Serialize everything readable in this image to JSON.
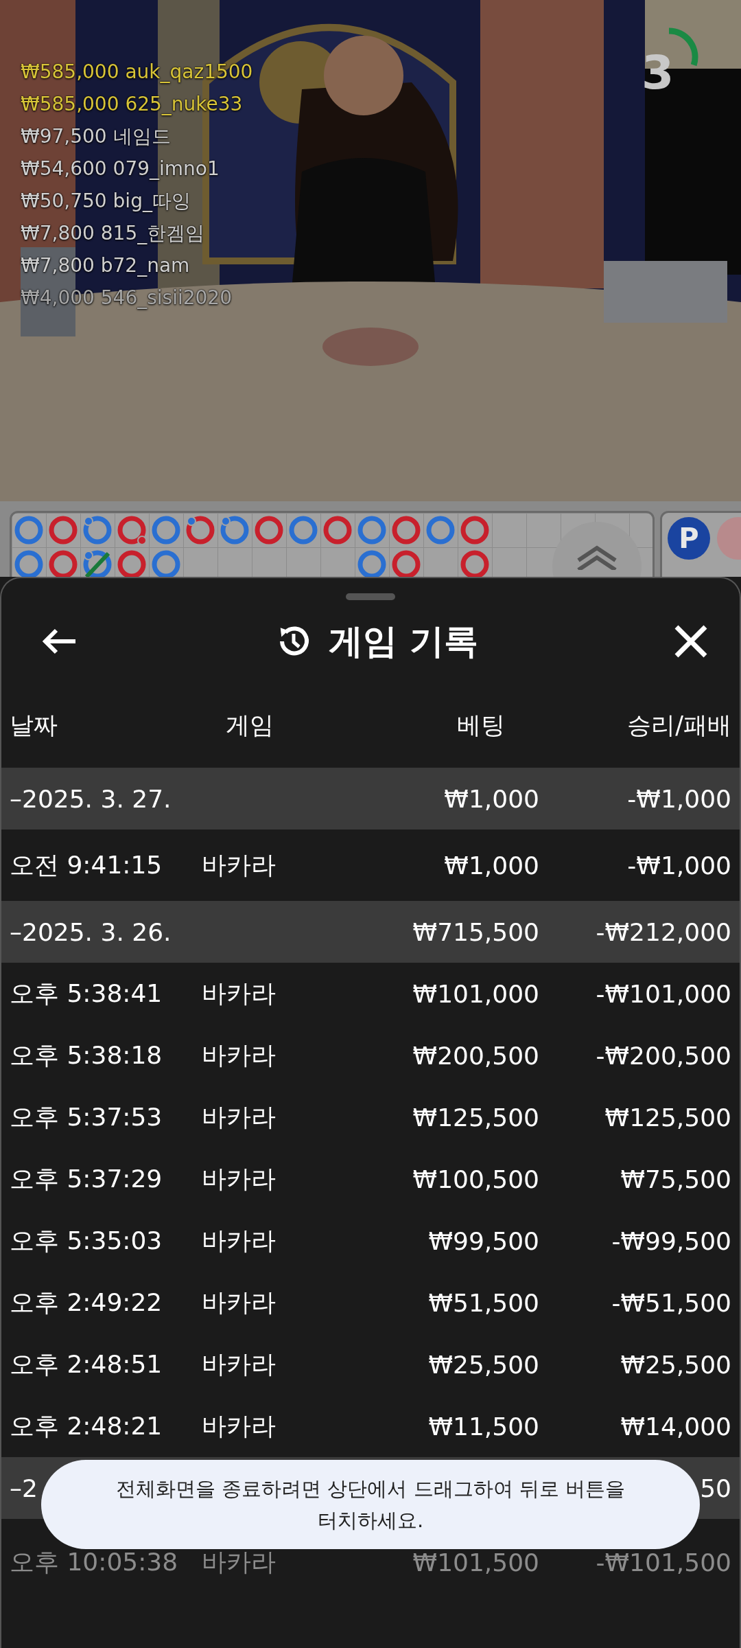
{
  "video": {
    "countdown": {
      "text": "3"
    },
    "bets": [
      {
        "amount": "₩585,000",
        "user": "auk_qaz1500",
        "kind": "top"
      },
      {
        "amount": "₩585,000",
        "user": "625_nuke33",
        "kind": "top"
      },
      {
        "amount": "₩97,500",
        "user": "네임드",
        "kind": "normal"
      },
      {
        "amount": "₩54,600",
        "user": "079_imno1",
        "kind": "normal"
      },
      {
        "amount": "₩50,750",
        "user": "big_따잉",
        "kind": "normal"
      },
      {
        "amount": "₩7,800",
        "user": "815_한겜임",
        "kind": "normal"
      },
      {
        "amount": "₩7,800",
        "user": "b72_nam",
        "kind": "normal"
      },
      {
        "amount": "₩4,000",
        "user": "546_sisii2020",
        "kind": "faded"
      }
    ]
  },
  "bead_road": {
    "rows": [
      [
        {
          "kind": "bead",
          "color": "#2a6fd1"
        },
        {
          "kind": "bead",
          "color": "#c8202c"
        },
        {
          "kind": "bead",
          "color": "#2a6fd1",
          "player_pair": true
        },
        {
          "kind": "bead",
          "color": "#c8202c",
          "banker_pair": true
        },
        {
          "kind": "bead",
          "color": "#2a6fd1"
        },
        {
          "kind": "bead",
          "color": "#c8202c",
          "player_pair": true
        },
        {
          "kind": "bead",
          "color": "#2a6fd1",
          "player_pair": true
        },
        {
          "kind": "bead",
          "color": "#c8202c"
        },
        {
          "kind": "bead",
          "color": "#2a6fd1"
        },
        {
          "kind": "bead",
          "color": "#c8202c"
        },
        {
          "kind": "bead",
          "color": "#2a6fd1"
        },
        {
          "kind": "bead",
          "color": "#c8202c"
        },
        {
          "kind": "bead",
          "color": "#2a6fd1"
        },
        {
          "kind": "bead",
          "color": "#c8202c"
        }
      ],
      [
        {
          "kind": "bead",
          "color": "#2a6fd1"
        },
        {
          "kind": "bead",
          "color": "#c8202c"
        },
        {
          "kind": "bead",
          "color": "#2a6fd1",
          "player_pair": true,
          "tie": true
        },
        {
          "kind": "bead",
          "color": "#c8202c"
        },
        {
          "kind": "bead",
          "color": "#2a6fd1"
        },
        {
          "kind": "empty"
        },
        {
          "kind": "empty"
        },
        {
          "kind": "empty"
        },
        {
          "kind": "empty"
        },
        {
          "kind": "empty"
        },
        {
          "kind": "bead",
          "color": "#2a6fd1"
        },
        {
          "kind": "bead",
          "color": "#c8202c"
        },
        {
          "kind": "empty"
        },
        {
          "kind": "bead",
          "color": "#c8202c"
        }
      ]
    ],
    "side_label": "P"
  },
  "sheet": {
    "title": "게임 기록",
    "columns": [
      "날짜",
      "게임",
      "베팅",
      "승리/패배"
    ],
    "rows": [
      {
        "kind": "day",
        "when": "–2025. 3. 27.",
        "bet": "₩1,000",
        "result": "-₩1,000",
        "faded": false
      },
      {
        "kind": "game",
        "when": "오전 9:41:15",
        "game": "바카라",
        "bet": "₩1,000",
        "result": "-₩1,000",
        "faded": false
      },
      {
        "kind": "day",
        "when": "–2025. 3. 26.",
        "bet": "₩715,500",
        "result": "-₩212,000",
        "faded": false
      },
      {
        "kind": "game",
        "when": "오후 5:38:41",
        "game": "바카라",
        "bet": "₩101,000",
        "result": "-₩101,000",
        "faded": false
      },
      {
        "kind": "game",
        "when": "오후 5:38:18",
        "game": "바카라",
        "bet": "₩200,500",
        "result": "-₩200,500",
        "faded": false
      },
      {
        "kind": "game",
        "when": "오후 5:37:53",
        "game": "바카라",
        "bet": "₩125,500",
        "result": "₩125,500",
        "faded": false
      },
      {
        "kind": "game",
        "when": "오후 5:37:29",
        "game": "바카라",
        "bet": "₩100,500",
        "result": "₩75,500",
        "faded": false
      },
      {
        "kind": "game",
        "when": "오후 5:35:03",
        "game": "바카라",
        "bet": "₩99,500",
        "result": "-₩99,500",
        "faded": false
      },
      {
        "kind": "game",
        "when": "오후 2:49:22",
        "game": "바카라",
        "bet": "₩51,500",
        "result": "-₩51,500",
        "faded": false
      },
      {
        "kind": "game",
        "when": "오후 2:48:51",
        "game": "바카라",
        "bet": "₩25,500",
        "result": "₩25,500",
        "faded": false
      },
      {
        "kind": "game",
        "when": "오후 2:48:21",
        "game": "바카라",
        "bet": "₩11,500",
        "result": "₩14,000",
        "faded": false
      },
      {
        "kind": "day",
        "when": "–2",
        "result": "50",
        "faded": false
      },
      {
        "kind": "game",
        "when": "오후 10:05:38",
        "game": "바카라",
        "bet": "₩101,500",
        "result": "-₩101,500",
        "faded": true
      }
    ]
  },
  "toast": "전체화면을 종료하려면 상단에서 드래그하여 뒤로 버튼을 터치하세요."
}
